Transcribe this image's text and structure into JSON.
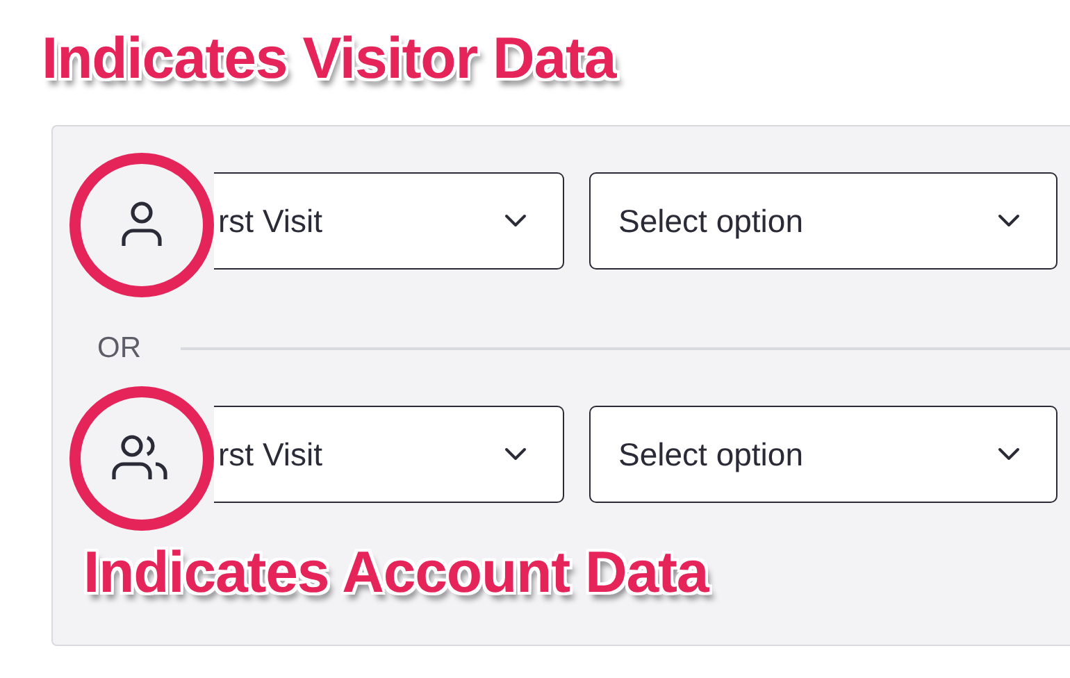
{
  "visitor_label": "Indicates Visitor Data",
  "conditions": [
    {
      "kind": "visitor",
      "field": "rst Visit",
      "value": "Select option"
    },
    {
      "kind": "account",
      "field": "rst Visit",
      "value": "Select option"
    }
  ],
  "separator": "OR",
  "account_label": "Indicates Account Data"
}
